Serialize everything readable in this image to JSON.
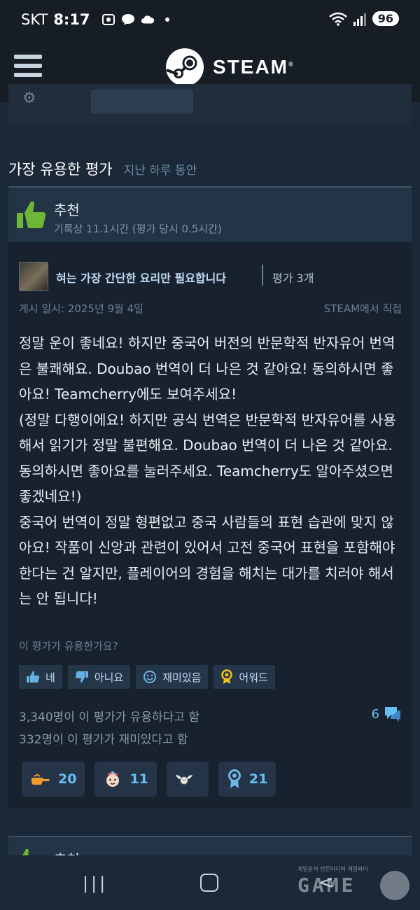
{
  "status_bar": {
    "carrier": "SKT",
    "time": "8:17",
    "battery": "96"
  },
  "header": {
    "logo_text": "STEAM",
    "registered": "®"
  },
  "section": {
    "title": "가장 유용한 평가",
    "period": "지난 하루 동안"
  },
  "review": {
    "recommendation": "추천",
    "hours": "기록상 11.1시간 (평가 당시 0.5시간)",
    "author": "혀는 가장 간단한 요리만 필요합니다",
    "review_count": "평가 3개",
    "posted": "게시 일시: 2025년 9월 4일",
    "source": "STEAM에서 직접",
    "text": [
      "정말 운이 좋네요! 하지만 중국어 버전의 반문학적 반자유어 번역은 불쾌해요. Doubao 번역이 더 나은 것 같아요! 동의하시면 좋아요! Teamcherry에도 보여주세요!",
      "(정말 다행이에요! 하지만 공식 번역은 반문학적 반자유어를 사용해서 읽기가 정말 불편해요. Doubao 번역이 더 나은 것 같아요. 동의하시면 좋아요를 눌러주세요. Teamcherry도 알아주셨으면 좋겠네요!)",
      "중국어 번역이 정말 형편없고 중국 사람들의 표현 습관에 맞지 않아요! 작품이 신앙과 관련이 있어서 고전 중국어 표현을 포함해야 한다는 건 알지만, 플레이어의 경험을 해치는 대가를 치러야 해서는 안 됩니다!"
    ],
    "helpful_question": "이 평가가 유용한가요?",
    "buttons": {
      "yes": "네",
      "no": "아니요",
      "funny": "재미있음",
      "award": "어워드"
    },
    "helpful_stat": "3,340명이 이 평가가 유용하다고 함",
    "funny_stat": "332명이 이 평가가 재미있다고 함",
    "comments": "6",
    "awards": [
      {
        "icon": "pointing-hand-icon",
        "count": "20"
      },
      {
        "icon": "face-icon",
        "count": "11"
      },
      {
        "icon": "winged-icon",
        "count": ""
      },
      {
        "icon": "ribbon-icon",
        "count": "21"
      }
    ]
  },
  "next_review": {
    "recommendation": "추천"
  },
  "watermark": {
    "tagline": "게임분석 전문미디어 게임와이",
    "logo": "GAME"
  }
}
